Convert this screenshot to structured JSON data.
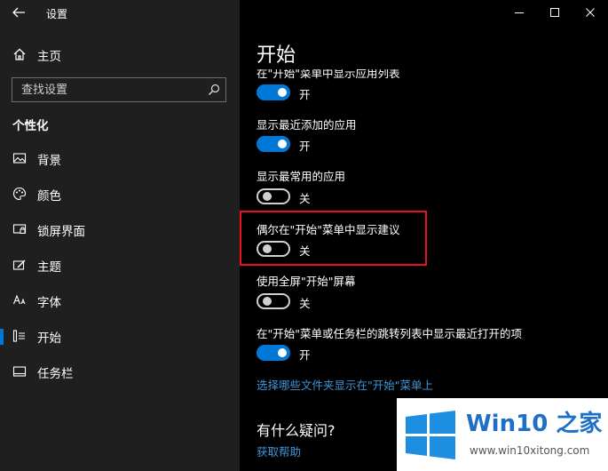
{
  "window": {
    "title": "设置"
  },
  "sidebar": {
    "home_label": "主页",
    "search_placeholder": "查找设置",
    "section": "个性化",
    "items": [
      {
        "label": "背景",
        "icon": "image-icon"
      },
      {
        "label": "颜色",
        "icon": "palette-icon"
      },
      {
        "label": "锁屏界面",
        "icon": "lock-screen-icon"
      },
      {
        "label": "主题",
        "icon": "theme-icon"
      },
      {
        "label": "字体",
        "icon": "font-icon"
      },
      {
        "label": "开始",
        "icon": "start-icon",
        "active": true
      },
      {
        "label": "任务栏",
        "icon": "taskbar-icon"
      }
    ]
  },
  "main": {
    "title": "开始",
    "settings": [
      {
        "label": "在\"开始\"菜单中显示应用列表",
        "state": "开",
        "on": true
      },
      {
        "label": "显示最近添加的应用",
        "state": "开",
        "on": true
      },
      {
        "label": "显示最常用的应用",
        "state": "关",
        "on": false
      },
      {
        "label": "偶尔在\"开始\"菜单中显示建议",
        "state": "关",
        "on": false
      },
      {
        "label": "使用全屏\"开始\"屏幕",
        "state": "关",
        "on": false
      },
      {
        "label": "在\"开始\"菜单或任务栏的跳转列表中显示最近打开的项",
        "state": "开",
        "on": true
      }
    ],
    "folders_link": "选择哪些文件夹显示在\"开始\"菜单上",
    "question_heading": "有什么疑问?",
    "help_link": "获取帮助"
  },
  "watermark": {
    "title": "Win10 之家",
    "url": "www.win10xitong.com"
  },
  "colors": {
    "accent": "#0078d7",
    "highlight": "#e81123",
    "link": "#3c96dc"
  }
}
